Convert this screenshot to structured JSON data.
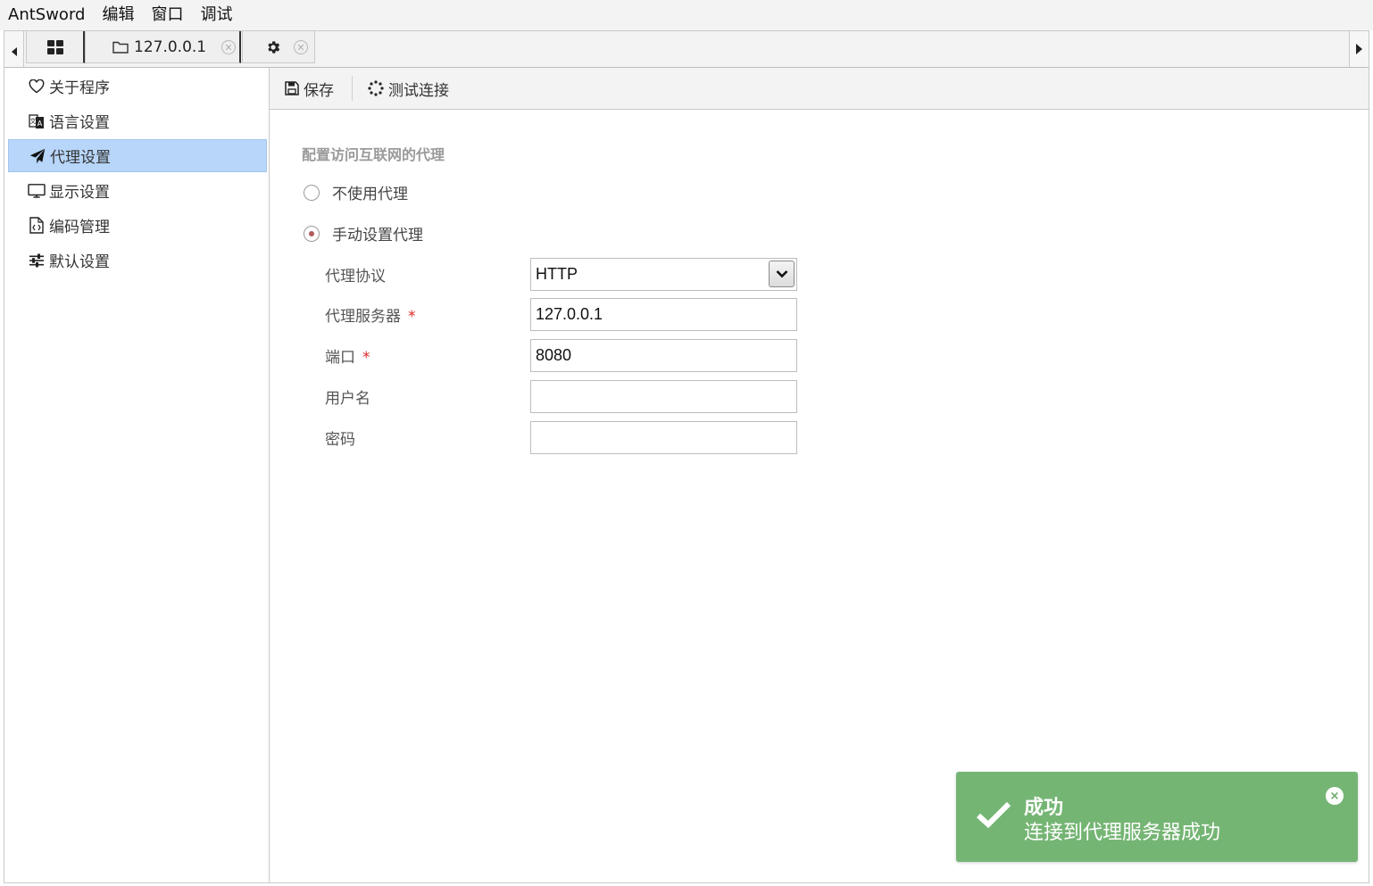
{
  "menubar": {
    "items": [
      "AntSword",
      "编辑",
      "窗口",
      "调试"
    ]
  },
  "tabs": {
    "home_icon": "grid-icon",
    "host": {
      "label": "127.0.0.1",
      "icon": "folder-icon"
    },
    "settings": {
      "icon": "gear-icon"
    }
  },
  "sidebar": {
    "items": [
      {
        "label": "关于程序",
        "icon": "heart-icon",
        "active": false
      },
      {
        "label": "语言设置",
        "icon": "translate-icon",
        "active": false
      },
      {
        "label": "代理设置",
        "icon": "paper-plane-icon",
        "active": true
      },
      {
        "label": "显示设置",
        "icon": "monitor-icon",
        "active": false
      },
      {
        "label": "编码管理",
        "icon": "code-file-icon",
        "active": false
      },
      {
        "label": "默认设置",
        "icon": "sliders-icon",
        "active": false
      }
    ]
  },
  "toolbar": {
    "save_label": "保存",
    "test_label": "测试连接"
  },
  "proxy": {
    "section_title": "配置访问互联网的代理",
    "option_none": "不使用代理",
    "option_manual": "手动设置代理",
    "selected_option": "manual",
    "protocol_label": "代理协议",
    "protocol_value": "HTTP",
    "server_label": "代理服务器",
    "server_value": "127.0.0.1",
    "port_label": "端口",
    "port_value": "8080",
    "username_label": "用户名",
    "username_value": "",
    "password_label": "密码",
    "password_value": "",
    "required_mark": "*"
  },
  "toast": {
    "title": "成功",
    "message": "连接到代理服务器成功",
    "close": "×",
    "color": "#75b574"
  },
  "colors": {
    "active_item_bg": "#b7d6fa",
    "required": "#e02828",
    "section_title": "#9a9a9a"
  }
}
